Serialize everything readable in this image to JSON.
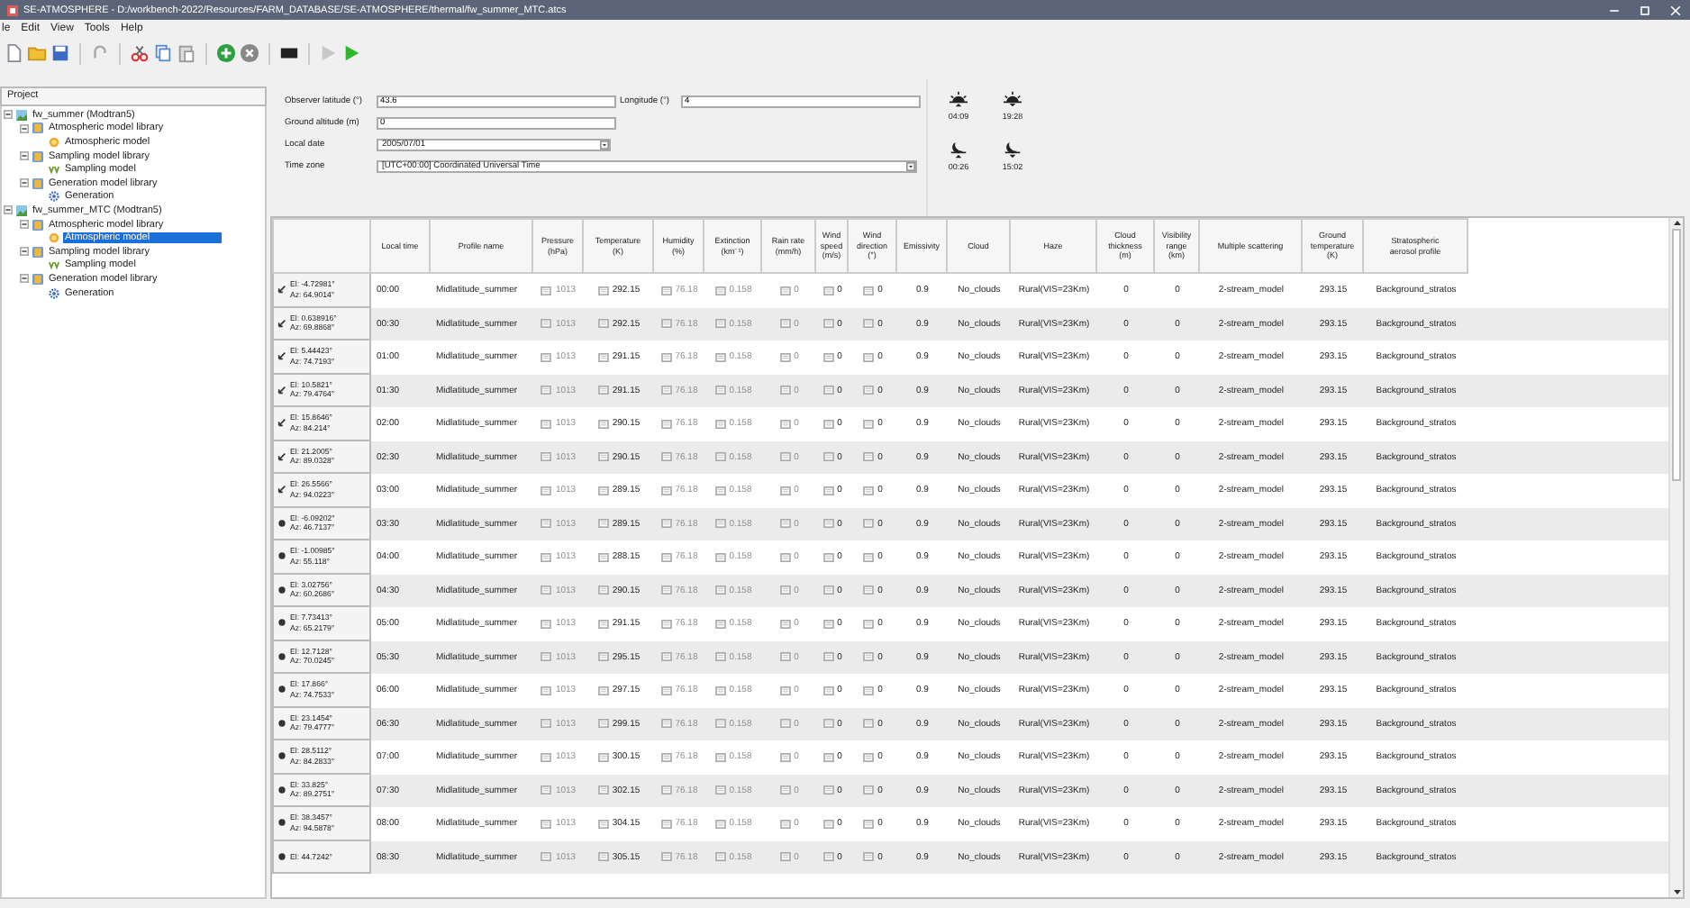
{
  "window": {
    "title": "SE-ATMOSPHERE - D:/workbench-2022/Resources/FARM_DATABASE/SE-ATMOSPHERE/thermal/fw_summer_MTC.atcs"
  },
  "menu": [
    "le",
    "Edit",
    "View",
    "Tools",
    "Help"
  ],
  "project_panel": {
    "title": "Project",
    "tree": [
      {
        "label": "fw_summer (Modtran5)",
        "kind": "project",
        "expanded": true,
        "selected": false,
        "children": [
          {
            "label": "Atmospheric model library",
            "kind": "library",
            "expanded": true,
            "selected": false,
            "children": [
              {
                "label": "Atmospheric model",
                "kind": "atmosphere",
                "selected": false
              }
            ]
          },
          {
            "label": "Sampling model library",
            "kind": "library",
            "expanded": true,
            "selected": false,
            "children": [
              {
                "label": "Sampling model",
                "kind": "sampling",
                "selected": false
              }
            ]
          },
          {
            "label": "Generation model library",
            "kind": "library",
            "expanded": true,
            "selected": false,
            "children": [
              {
                "label": "Generation",
                "kind": "generation",
                "selected": false
              }
            ]
          }
        ]
      },
      {
        "label": "fw_summer_MTC (Modtran5)",
        "kind": "project",
        "expanded": true,
        "selected": false,
        "children": [
          {
            "label": "Atmospheric model library",
            "kind": "library",
            "expanded": true,
            "selected": false,
            "children": [
              {
                "label": "Atmospheric model",
                "kind": "atmosphere",
                "selected": true
              }
            ]
          },
          {
            "label": "Sampling model library",
            "kind": "library",
            "expanded": true,
            "selected": false,
            "children": [
              {
                "label": "Sampling model",
                "kind": "sampling",
                "selected": false
              }
            ]
          },
          {
            "label": "Generation model library",
            "kind": "library",
            "expanded": true,
            "selected": false,
            "children": [
              {
                "label": "Generation",
                "kind": "generation",
                "selected": false
              }
            ]
          }
        ]
      }
    ]
  },
  "site": {
    "latitude": {
      "label": "Observer latitude (°)",
      "value": "43.6"
    },
    "longitude": {
      "label": "Longitude (°)",
      "value": "4"
    },
    "altitude": {
      "label": "Ground altitude (m)",
      "value": "0"
    },
    "local_date": {
      "label": "Local date",
      "value": "2005/07/01"
    },
    "time_zone": {
      "label": "Time zone",
      "value": "[UTC+00:00] Coordinated Universal Time"
    }
  },
  "ephemeris": [
    {
      "kind": "sunrise",
      "time": "04:09"
    },
    {
      "kind": "sunset",
      "time": "19:28"
    },
    {
      "kind": "moonrise",
      "time": "00:26"
    },
    {
      "kind": "moonset",
      "time": "15:02"
    }
  ],
  "table": {
    "columns": [
      {
        "label": "Local time",
        "kind": "text",
        "disabled": false
      },
      {
        "label": "Profile name",
        "kind": "text",
        "disabled": false
      },
      {
        "label": "Pressure\n(hPa)",
        "kind": "toggle",
        "disabled": true
      },
      {
        "label": "Temperature\n(K)",
        "kind": "toggle",
        "disabled": false
      },
      {
        "label": "Humidity\n(%)",
        "kind": "toggle",
        "disabled": true
      },
      {
        "label": "Extinction\n(km⁻¹)",
        "kind": "toggle",
        "disabled": true
      },
      {
        "label": "Rain rate\n(mm/h)",
        "kind": "toggle",
        "disabled": true
      },
      {
        "label": "Wind\nspeed\n(m/s)",
        "kind": "toggle",
        "disabled": false
      },
      {
        "label": "Wind\ndirection\n(°)",
        "kind": "toggle",
        "disabled": false
      },
      {
        "label": "Emissivity",
        "kind": "text",
        "disabled": false
      },
      {
        "label": "Cloud",
        "kind": "text",
        "disabled": false
      },
      {
        "label": "Haze",
        "kind": "text",
        "disabled": false
      },
      {
        "label": "Cloud\nthickness\n(m)",
        "kind": "text",
        "disabled": false
      },
      {
        "label": "Visibility\nrange\n(km)",
        "kind": "text",
        "disabled": false
      },
      {
        "label": "Multiple scattering",
        "kind": "text",
        "disabled": false
      },
      {
        "label": "Ground\ntemperature\n(K)",
        "kind": "text",
        "disabled": false
      },
      {
        "label": "Stratospheric\naerosol profile",
        "kind": "text",
        "disabled": false
      }
    ],
    "rows": [
      {
        "kind": "arrow",
        "el": "El: -4.72981°",
        "az": "Az: 64.9014°",
        "cells": [
          "00:00",
          "Midlatitude_summer",
          "1013",
          "292.15",
          "76.18",
          "0.158",
          "0",
          "0",
          "0",
          "0.9",
          "No_clouds",
          "Rural(VIS=23Km)",
          "0",
          "0",
          "2-stream_model",
          "293.15",
          "Background_stratos"
        ]
      },
      {
        "kind": "arrow",
        "el": "El: 0.638916°",
        "az": "Az: 69.8868°",
        "cells": [
          "00:30",
          "Midlatitude_summer",
          "1013",
          "292.15",
          "76.18",
          "0.158",
          "0",
          "0",
          "0",
          "0.9",
          "No_clouds",
          "Rural(VIS=23Km)",
          "0",
          "0",
          "2-stream_model",
          "293.15",
          "Background_stratos"
        ]
      },
      {
        "kind": "arrow",
        "el": "El: 5.44423°",
        "az": "Az: 74.7193°",
        "cells": [
          "01:00",
          "Midlatitude_summer",
          "1013",
          "291.15",
          "76.18",
          "0.158",
          "0",
          "0",
          "0",
          "0.9",
          "No_clouds",
          "Rural(VIS=23Km)",
          "0",
          "0",
          "2-stream_model",
          "293.15",
          "Background_stratos"
        ]
      },
      {
        "kind": "arrow",
        "el": "El: 10.5821°",
        "az": "Az: 79.4764°",
        "cells": [
          "01:30",
          "Midlatitude_summer",
          "1013",
          "291.15",
          "76.18",
          "0.158",
          "0",
          "0",
          "0",
          "0.9",
          "No_clouds",
          "Rural(VIS=23Km)",
          "0",
          "0",
          "2-stream_model",
          "293.15",
          "Background_stratos"
        ]
      },
      {
        "kind": "arrow",
        "el": "El: 15.8646°",
        "az": "Az: 84.214°",
        "cells": [
          "02:00",
          "Midlatitude_summer",
          "1013",
          "290.15",
          "76.18",
          "0.158",
          "0",
          "0",
          "0",
          "0.9",
          "No_clouds",
          "Rural(VIS=23Km)",
          "0",
          "0",
          "2-stream_model",
          "293.15",
          "Background_stratos"
        ]
      },
      {
        "kind": "arrow",
        "el": "El: 21.2005°",
        "az": "Az: 89.0328°",
        "cells": [
          "02:30",
          "Midlatitude_summer",
          "1013",
          "290.15",
          "76.18",
          "0.158",
          "0",
          "0",
          "0",
          "0.9",
          "No_clouds",
          "Rural(VIS=23Km)",
          "0",
          "0",
          "2-stream_model",
          "293.15",
          "Background_stratos"
        ]
      },
      {
        "kind": "arrow",
        "el": "El: 26.5566°",
        "az": "Az: 94.0223°",
        "cells": [
          "03:00",
          "Midlatitude_summer",
          "1013",
          "289.15",
          "76.18",
          "0.158",
          "0",
          "0",
          "0",
          "0.9",
          "No_clouds",
          "Rural(VIS=23Km)",
          "0",
          "0",
          "2-stream_model",
          "293.15",
          "Background_stratos"
        ]
      },
      {
        "kind": "dot",
        "el": "El: -6.09202°",
        "az": "Az: 46.7137°",
        "cells": [
          "03:30",
          "Midlatitude_summer",
          "1013",
          "289.15",
          "76.18",
          "0.158",
          "0",
          "0",
          "0",
          "0.9",
          "No_clouds",
          "Rural(VIS=23Km)",
          "0",
          "0",
          "2-stream_model",
          "293.15",
          "Background_stratos"
        ]
      },
      {
        "kind": "dot",
        "el": "El: -1.00985°",
        "az": "Az: 55.118°",
        "cells": [
          "04:00",
          "Midlatitude_summer",
          "1013",
          "288.15",
          "76.18",
          "0.158",
          "0",
          "0",
          "0",
          "0.9",
          "No_clouds",
          "Rural(VIS=23Km)",
          "0",
          "0",
          "2-stream_model",
          "293.15",
          "Background_stratos"
        ]
      },
      {
        "kind": "dot",
        "el": "El: 3.02756°",
        "az": "Az: 60.2686°",
        "cells": [
          "04:30",
          "Midlatitude_summer",
          "1013",
          "290.15",
          "76.18",
          "0.158",
          "0",
          "0",
          "0",
          "0.9",
          "No_clouds",
          "Rural(VIS=23Km)",
          "0",
          "0",
          "2-stream_model",
          "293.15",
          "Background_stratos"
        ]
      },
      {
        "kind": "dot",
        "el": "El: 7.73413°",
        "az": "Az: 65.2179°",
        "cells": [
          "05:00",
          "Midlatitude_summer",
          "1013",
          "291.15",
          "76.18",
          "0.158",
          "0",
          "0",
          "0",
          "0.9",
          "No_clouds",
          "Rural(VIS=23Km)",
          "0",
          "0",
          "2-stream_model",
          "293.15",
          "Background_stratos"
        ]
      },
      {
        "kind": "dot",
        "el": "El: 12.7128°",
        "az": "Az: 70.0245°",
        "cells": [
          "05:30",
          "Midlatitude_summer",
          "1013",
          "295.15",
          "76.18",
          "0.158",
          "0",
          "0",
          "0",
          "0.9",
          "No_clouds",
          "Rural(VIS=23Km)",
          "0",
          "0",
          "2-stream_model",
          "293.15",
          "Background_stratos"
        ]
      },
      {
        "kind": "dot",
        "el": "El: 17.866°",
        "az": "Az: 74.7533°",
        "cells": [
          "06:00",
          "Midlatitude_summer",
          "1013",
          "297.15",
          "76.18",
          "0.158",
          "0",
          "0",
          "0",
          "0.9",
          "No_clouds",
          "Rural(VIS=23Km)",
          "0",
          "0",
          "2-stream_model",
          "293.15",
          "Background_stratos"
        ]
      },
      {
        "kind": "dot",
        "el": "El: 23.1454°",
        "az": "Az: 79.4777°",
        "cells": [
          "06:30",
          "Midlatitude_summer",
          "1013",
          "299.15",
          "76.18",
          "0.158",
          "0",
          "0",
          "0",
          "0.9",
          "No_clouds",
          "Rural(VIS=23Km)",
          "0",
          "0",
          "2-stream_model",
          "293.15",
          "Background_stratos"
        ]
      },
      {
        "kind": "dot",
        "el": "El: 28.5112°",
        "az": "Az: 84.2833°",
        "cells": [
          "07:00",
          "Midlatitude_summer",
          "1013",
          "300.15",
          "76.18",
          "0.158",
          "0",
          "0",
          "0",
          "0.9",
          "No_clouds",
          "Rural(VIS=23Km)",
          "0",
          "0",
          "2-stream_model",
          "293.15",
          "Background_stratos"
        ]
      },
      {
        "kind": "dot",
        "el": "El: 33.825°",
        "az": "Az: 89.2751°",
        "cells": [
          "07:30",
          "Midlatitude_summer",
          "1013",
          "302.15",
          "76.18",
          "0.158",
          "0",
          "0",
          "0",
          "0.9",
          "No_clouds",
          "Rural(VIS=23Km)",
          "0",
          "0",
          "2-stream_model",
          "293.15",
          "Background_stratos"
        ]
      },
      {
        "kind": "dot",
        "el": "El: 38.3457°",
        "az": "Az: 94.5878°",
        "cells": [
          "08:00",
          "Midlatitude_summer",
          "1013",
          "304.15",
          "76.18",
          "0.158",
          "0",
          "0",
          "0",
          "0.9",
          "No_clouds",
          "Rural(VIS=23Km)",
          "0",
          "0",
          "2-stream_model",
          "293.15",
          "Background_stratos"
        ]
      },
      {
        "kind": "dot",
        "el": "El: 44.7242°",
        "cells": [
          "08:30",
          "Midlatitude_summer",
          "1013",
          "305.15",
          "76.18",
          "0.158",
          "0",
          "0",
          "0",
          "0.9",
          "No_clouds",
          "Rural(VIS=23Km)",
          "0",
          "0",
          "2-stream_model",
          "293.15",
          "Background_stratos"
        ]
      }
    ]
  }
}
